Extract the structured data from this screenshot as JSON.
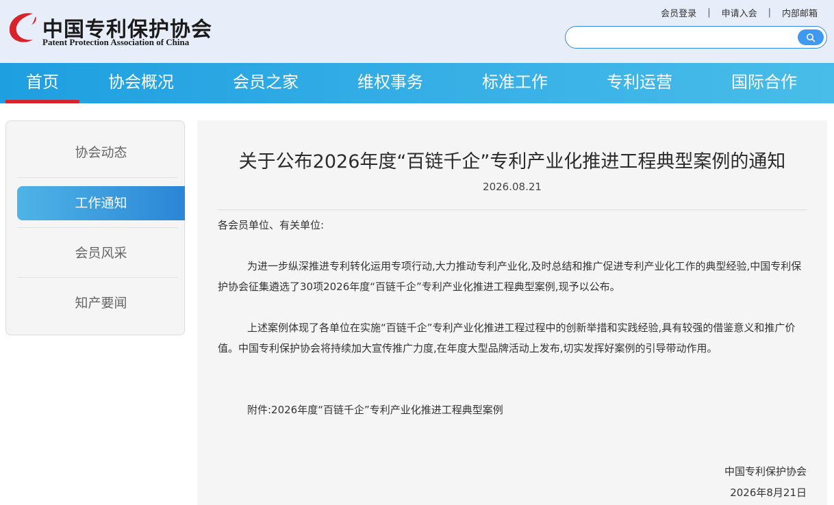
{
  "header": {
    "logo_cn": "中国专利保护协会",
    "logo_en": "Patent Protection Association of China",
    "links": [
      "会员登录",
      "申请入会",
      "内部邮箱"
    ],
    "search_placeholder": "",
    "colors": {
      "brand_red": "#d8232a",
      "nav_blue": "#2ea7e4",
      "header_bg": "#e8eef9"
    }
  },
  "nav": {
    "items": [
      "首页",
      "协会概况",
      "会员之家",
      "维权事务",
      "标准工作",
      "专利运营",
      "国际合作"
    ],
    "active_index": 0
  },
  "sidebar": {
    "items": [
      "协会动态",
      "工作通知",
      "会员风采",
      "知产要闻"
    ],
    "active_index": 1
  },
  "article": {
    "title": "关于公布2026年度“百链千企”专利产业化推进工程典型案例的通知",
    "date": "2026.08.21",
    "salutation": "各会员单位、有关单位:",
    "paragraphs": [
      "为进一步纵深推进专利转化运用专项行动,大力推动专利产业化,及时总结和推广促进专利产业化工作的典型经验,中国专利保护协会征集遴选了30项2026年度“百链千企”专利产业化推进工程典型案例,现予以公布。",
      "上述案例体现了各单位在实施“百链千企”专利产业化推进工程过程中的创新举措和实践经验,具有较强的借鉴意义和推广价值。中国专利保护协会将持续加大宣传推广力度,在年度大型品牌活动上发布,切实发挥好案例的引导带动作用。"
    ],
    "attachment": "附件:2026年度“百链千企”专利产业化推进工程典型案例",
    "signature_org": "中国专利保护协会",
    "signature_date": "2026年8月21日"
  }
}
